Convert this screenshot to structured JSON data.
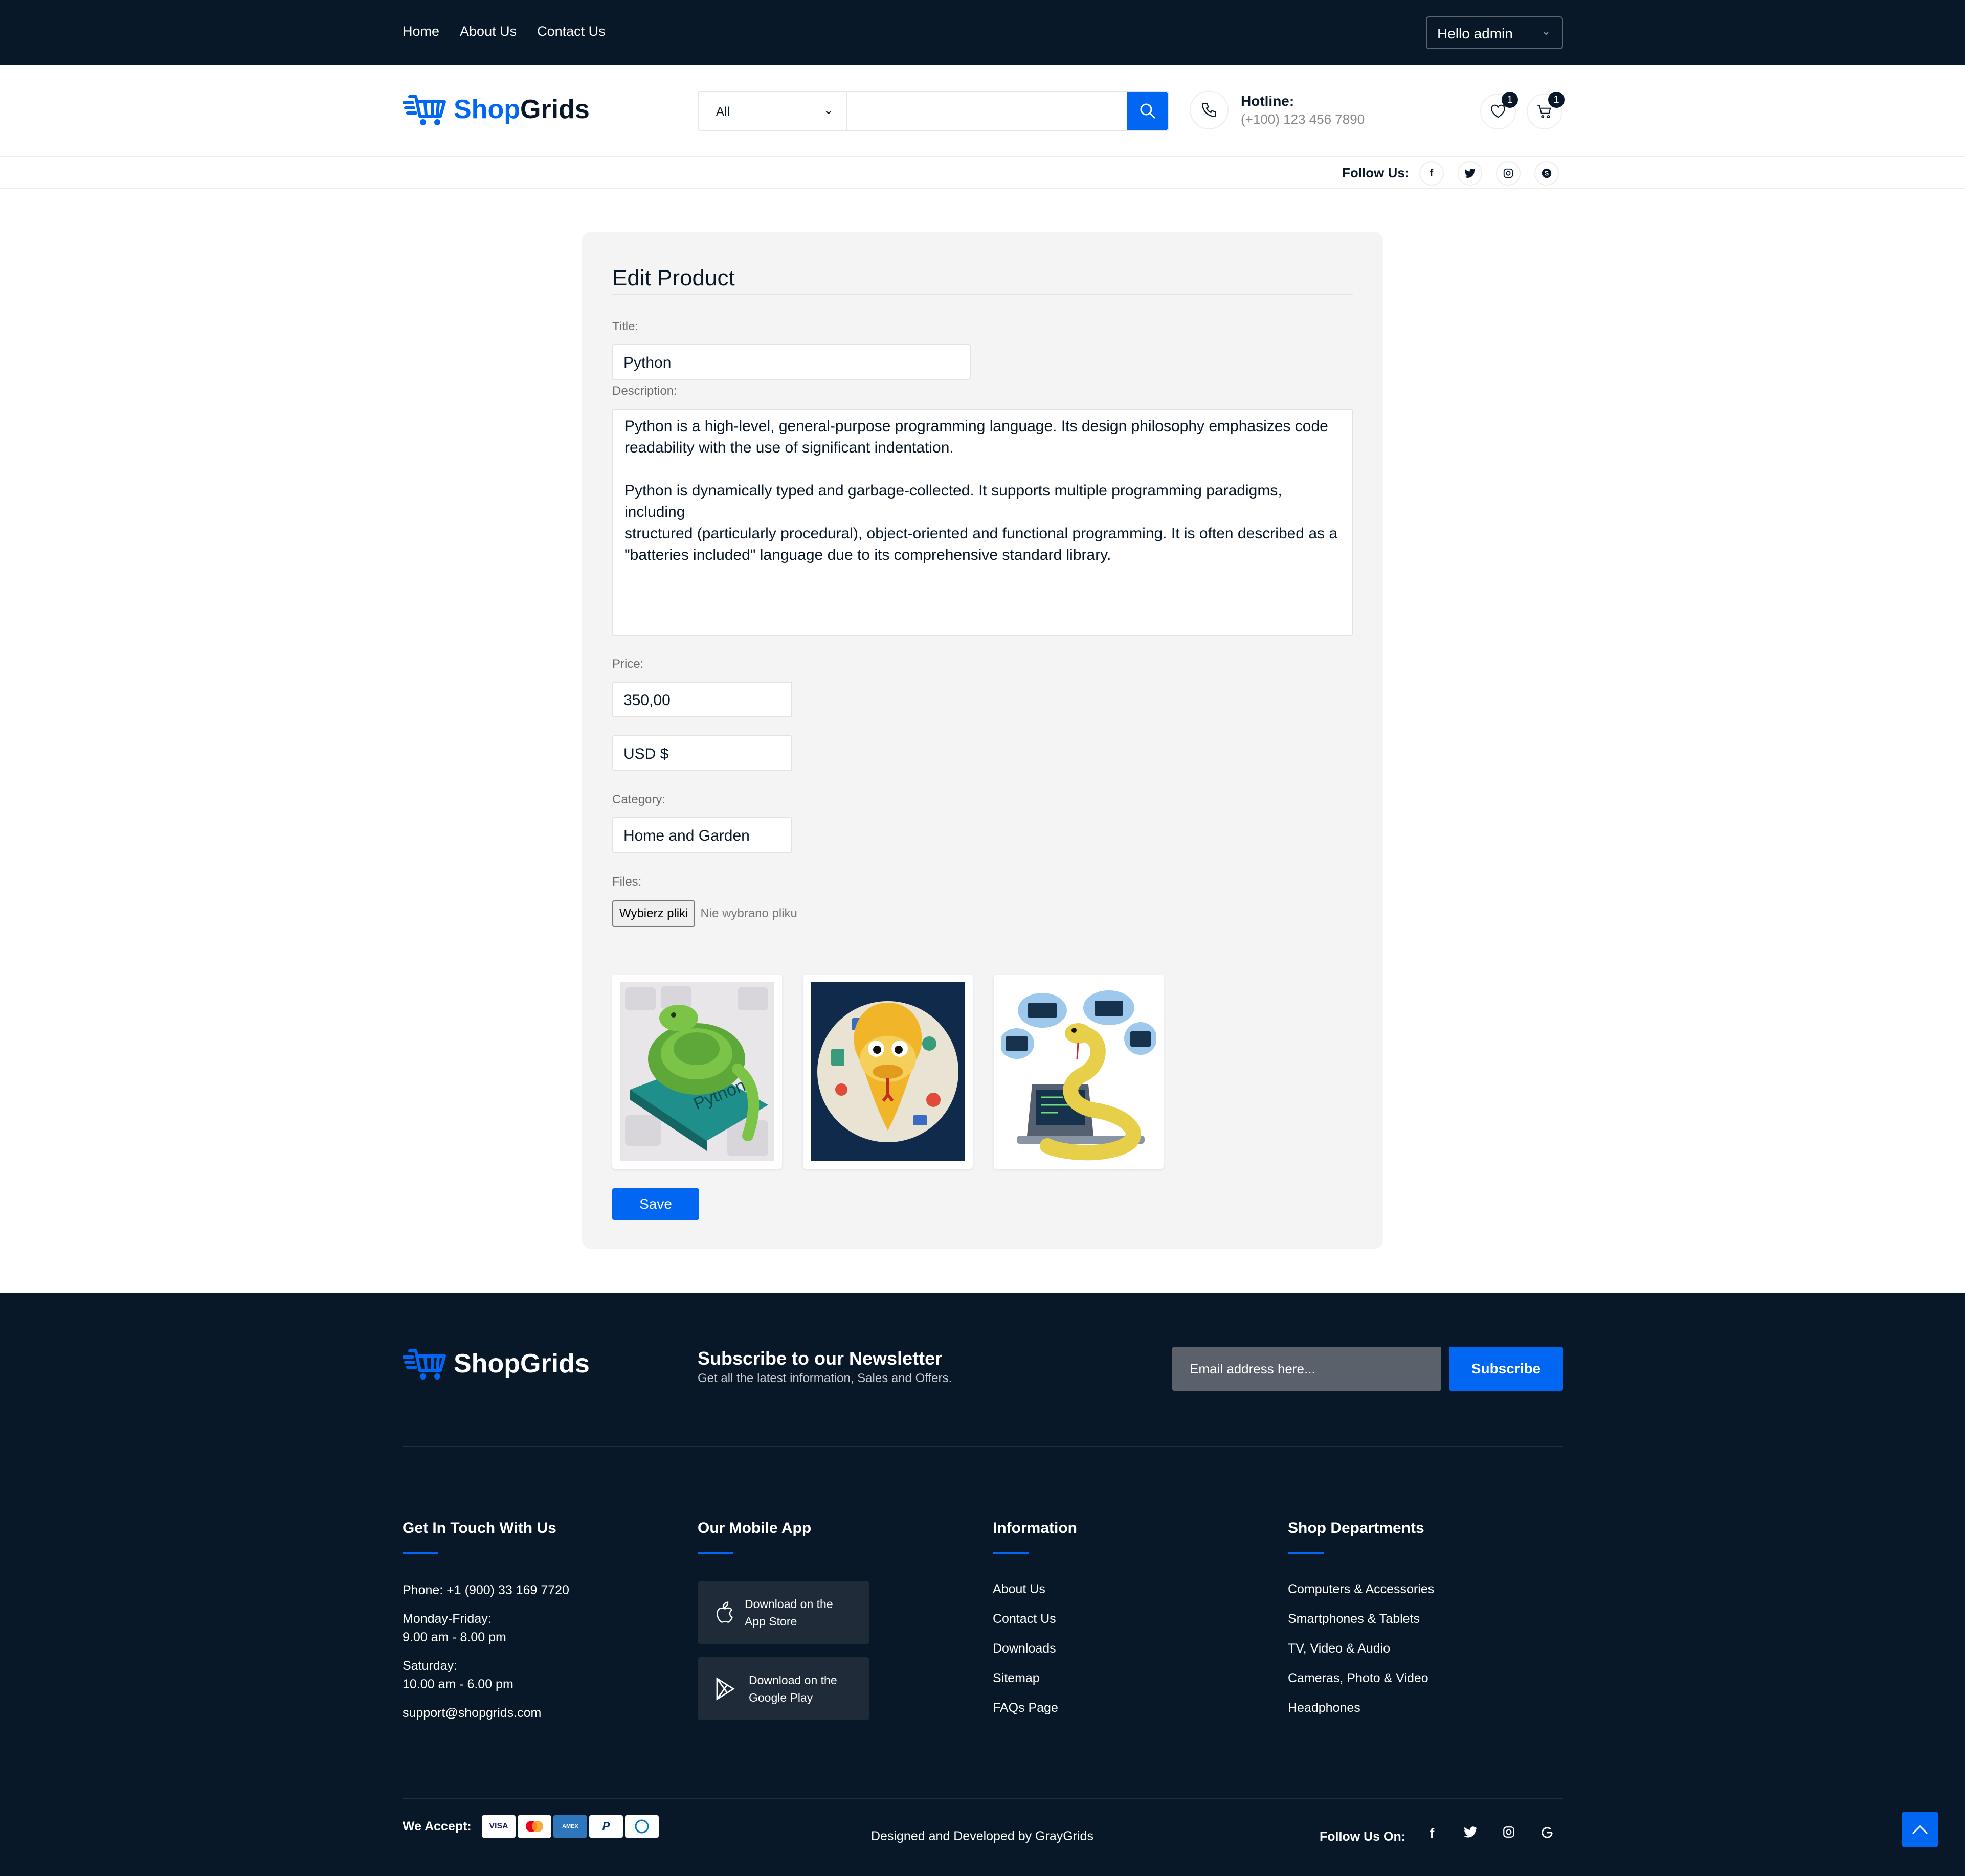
{
  "topbar": {
    "nav": [
      "Home",
      "About Us",
      "Contact Us"
    ],
    "user_menu": "Hello admin"
  },
  "header": {
    "brand_shop": "Shop",
    "brand_grids": "Grids",
    "search_category": "All",
    "search_value": "",
    "hotline_label": "Hotline:",
    "hotline_number": "(+100) 123 456 7890",
    "wishlist_count": "1",
    "cart_count": "1",
    "follow_label": "Follow Us:"
  },
  "form": {
    "title": "Edit Product",
    "title_label": "Title:",
    "title_value": "Python",
    "description_label": "Description:",
    "description_value": "Python is a high-level, general-purpose programming language. Its design philosophy emphasizes code\nreadability with the use of significant indentation.\n\nPython is dynamically typed and garbage-collected. It supports multiple programming paradigms, including\nstructured (particularly procedural), object-oriented and functional programming. It is often described as a\n\"batteries included\" language due to its comprehensive standard library.",
    "price_label": "Price:",
    "price_value": "350,00",
    "currency_value": "USD $",
    "category_label": "Category:",
    "category_value": "Home and Garden",
    "files_label": "Files:",
    "file_button": "Wybierz pliki",
    "file_none": "Nie wybrano pliku",
    "thumb_keyboard_text": "Python",
    "save_label": "Save"
  },
  "footer": {
    "brand": "ShopGrids",
    "newsletter_title": "Subscribe to our Newsletter",
    "newsletter_sub": "Get all the latest information, Sales and Offers.",
    "email_placeholder": "Email address here...",
    "subscribe_label": "Subscribe",
    "contact_title": "Get In Touch With Us",
    "phone": "Phone: +1 (900) 33 169 7720",
    "weekday_label": "Monday-Friday:",
    "weekday_hours": "9.00 am - 8.00 pm",
    "saturday_label": "Saturday:",
    "saturday_hours": "10.00 am - 6.00 pm",
    "email": "support@shopgrids.com",
    "app_title": "Our Mobile App",
    "app_store_line1": "Download on the",
    "app_store_line2": "App Store",
    "play_line1": "Download on the",
    "play_line2": "Google Play",
    "info_title": "Information",
    "info_links": [
      "About Us",
      "Contact Us",
      "Downloads",
      "Sitemap",
      "FAQs Page"
    ],
    "dept_title": "Shop Departments",
    "dept_links": [
      "Computers & Accessories",
      "Smartphones & Tablets",
      "TV, Video & Audio",
      "Cameras, Photo & Video",
      "Headphones"
    ],
    "we_accept": "We Accept:",
    "payment_cards": [
      "VISA",
      "MC",
      "AMEX",
      "PayPal",
      "Diners"
    ],
    "credit": "Designed and Developed by GrayGrids",
    "follow_on": "Follow Us On:"
  },
  "colors": {
    "primary": "#0167f3",
    "dark": "#081828"
  },
  "icons": [
    "cart-logo-icon",
    "search-icon",
    "phone-icon",
    "heart-icon",
    "cart-icon",
    "facebook-icon",
    "twitter-icon",
    "instagram-icon",
    "skype-icon",
    "google-icon",
    "apple-icon",
    "play-icon",
    "arrow-up-icon"
  ]
}
